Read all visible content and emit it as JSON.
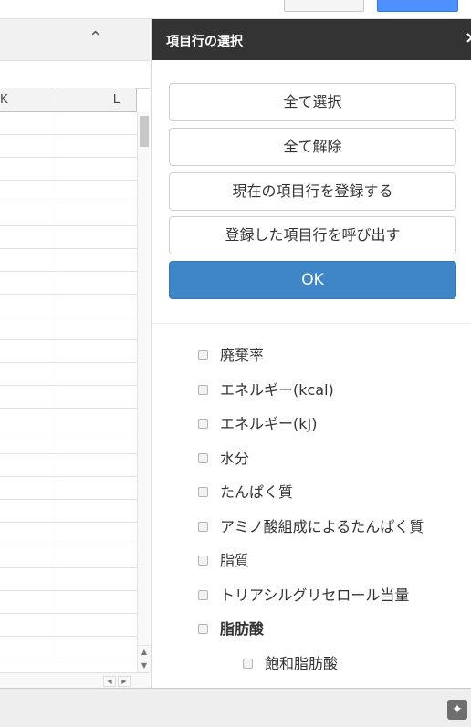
{
  "sheet": {
    "collapse_icon": "⌃",
    "columns": [
      "K",
      "L"
    ],
    "row_count": 24
  },
  "panel": {
    "title": "項目行の選択",
    "close_icon": "×",
    "buttons": [
      "全て選択",
      "全て解除",
      "現在の項目行を登録する",
      "登録した項目行を呼び出す"
    ],
    "ok_label": "OK",
    "items": [
      {
        "label": "廃棄率",
        "bold": false,
        "indent": 0
      },
      {
        "label": "エネルギー(kcal)",
        "bold": false,
        "indent": 0
      },
      {
        "label": "エネルギー(kJ)",
        "bold": false,
        "indent": 0
      },
      {
        "label": "水分",
        "bold": false,
        "indent": 0
      },
      {
        "label": "たんぱく質",
        "bold": false,
        "indent": 0
      },
      {
        "label": "アミノ酸組成によるたんぱく質",
        "bold": false,
        "indent": 0
      },
      {
        "label": "脂質",
        "bold": false,
        "indent": 0
      },
      {
        "label": "トリアシルグリセロール当量",
        "bold": false,
        "indent": 0
      },
      {
        "label": "脂肪酸",
        "bold": true,
        "indent": 0
      },
      {
        "label": "飽和脂肪酸",
        "bold": false,
        "indent": 1
      }
    ]
  },
  "bottom": {
    "explore_icon": "explore-icon"
  }
}
